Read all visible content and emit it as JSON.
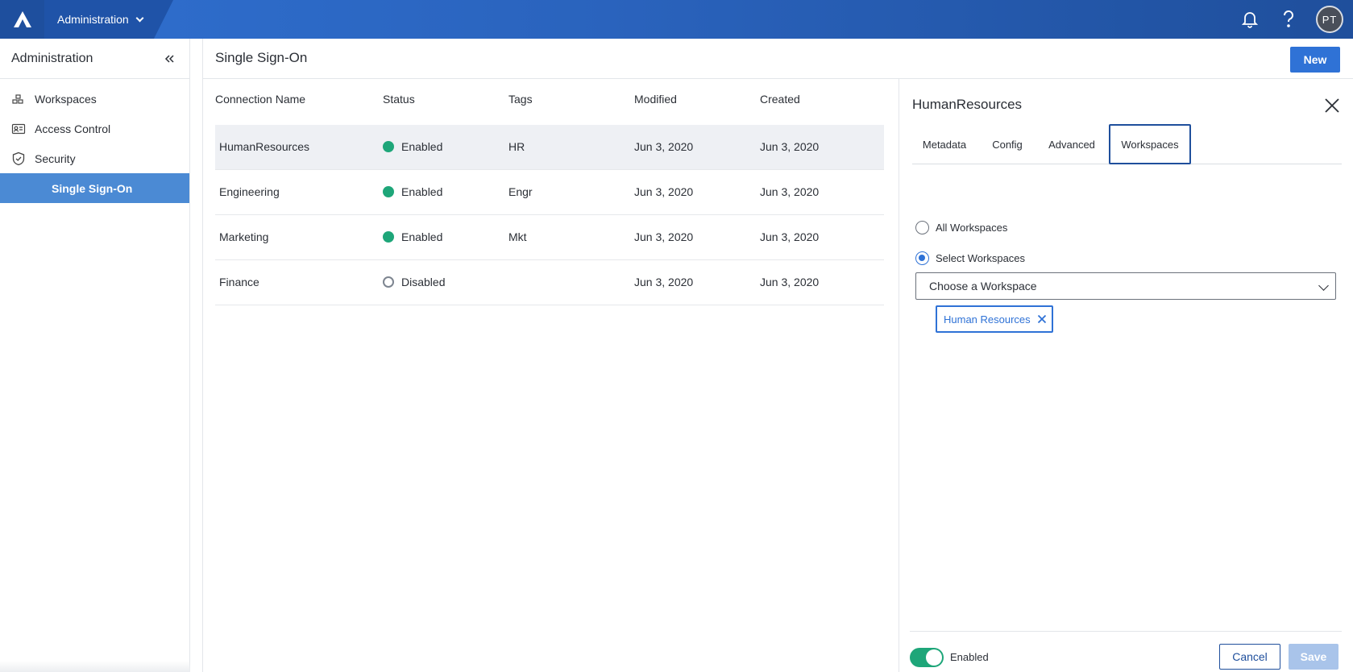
{
  "topbar": {
    "app_name": "Administration",
    "avatar_initials": "PT",
    "icons": [
      "logo-icon",
      "bell-icon",
      "help-icon"
    ]
  },
  "sidebar": {
    "title": "Administration",
    "items": [
      {
        "label": "Workspaces",
        "icon": "workspaces-icon"
      },
      {
        "label": "Access Control",
        "icon": "id-card-icon"
      },
      {
        "label": "Security",
        "icon": "shield-icon"
      },
      {
        "label": "Single Sign-On",
        "active": true
      }
    ]
  },
  "main": {
    "title": "Single Sign-On",
    "new_label": "New",
    "columns": [
      "Connection Name",
      "Status",
      "Tags",
      "Modified",
      "Created"
    ],
    "rows": [
      {
        "name": "HumanResources",
        "status": "Enabled",
        "enabled": true,
        "tags": "HR",
        "modified": "Jun 3, 2020",
        "created": "Jun 3, 2020"
      },
      {
        "name": "Engineering",
        "status": "Enabled",
        "enabled": true,
        "tags": "Engr",
        "modified": "Jun 3, 2020",
        "created": "Jun 3, 2020"
      },
      {
        "name": "Marketing",
        "status": "Enabled",
        "enabled": true,
        "tags": "Mkt",
        "modified": "Jun 3, 2020",
        "created": "Jun 3, 2020"
      },
      {
        "name": "Finance",
        "status": "Disabled",
        "enabled": false,
        "tags": "",
        "modified": "Jun 3, 2020",
        "created": "Jun 3, 2020"
      }
    ]
  },
  "panel": {
    "title": "HumanResources",
    "tabs": [
      "Metadata",
      "Config",
      "Advanced",
      "Workspaces"
    ],
    "active_tab": "Workspaces",
    "radio_all": "All Workspaces",
    "radio_select": "Select Workspaces",
    "selected_radio": "Select Workspaces",
    "select_placeholder": "Choose a Workspace",
    "chip": "Human Resources",
    "toggle_label": "Enabled",
    "toggle_on": true,
    "cancel_label": "Cancel",
    "save_label": "Save"
  },
  "colors": {
    "accent": "#2f72d6",
    "enabled_green": "#1ea679",
    "nav_active": "#4b8ad4",
    "topbar_dark": "#1f4f9c"
  }
}
